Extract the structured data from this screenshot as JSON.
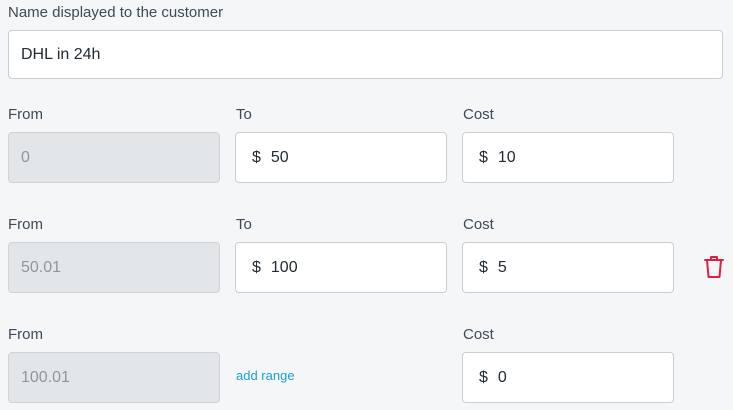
{
  "name_field": {
    "label": "Name displayed to the customer",
    "value": "DHL in 24h"
  },
  "currency_symbol": "$",
  "ranges": [
    {
      "from_label": "From",
      "to_label": "To",
      "cost_label": "Cost",
      "from_value": "0",
      "to_value": "50",
      "cost_value": "10"
    },
    {
      "from_label": "From",
      "to_label": "To",
      "cost_label": "Cost",
      "from_value": "50.01",
      "to_value": "100",
      "cost_value": "5",
      "delete_icon": "trash-icon"
    },
    {
      "from_label": "From",
      "cost_label": "Cost",
      "from_value": "100.01",
      "cost_value": "0"
    }
  ],
  "add_range_label": "add range",
  "colors": {
    "delete": "#e0203c",
    "link": "#1a9fd8",
    "background": "#f5f6f8"
  }
}
